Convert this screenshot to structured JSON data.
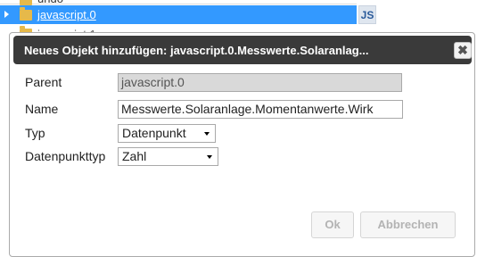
{
  "background_tree": {
    "partial_label": "undo",
    "selected_label": "javascript.0",
    "next_label": "javascript.1",
    "badge": "JS"
  },
  "dialog": {
    "title": "Neues Objekt hinzufügen: javascript.0.Messwerte.Solaranlag...",
    "close_symbol": "✖",
    "fields": {
      "parent_label": "Parent",
      "parent_value": "javascript.0",
      "name_label": "Name",
      "name_value": "Messwerte.Solaranlage.Momentanwerte.Wirk",
      "typ_label": "Typ",
      "typ_value": "Datenpunkt",
      "datenpunkttyp_label": "Datenpunkttyp",
      "datenpunkttyp_value": "Zahl"
    },
    "buttons": {
      "ok": "Ok",
      "cancel": "Abbrechen"
    }
  },
  "colors": {
    "selection": "#3399ff",
    "titlebar": "#3a3a3a",
    "readonly_field": "#d9d9d9"
  }
}
